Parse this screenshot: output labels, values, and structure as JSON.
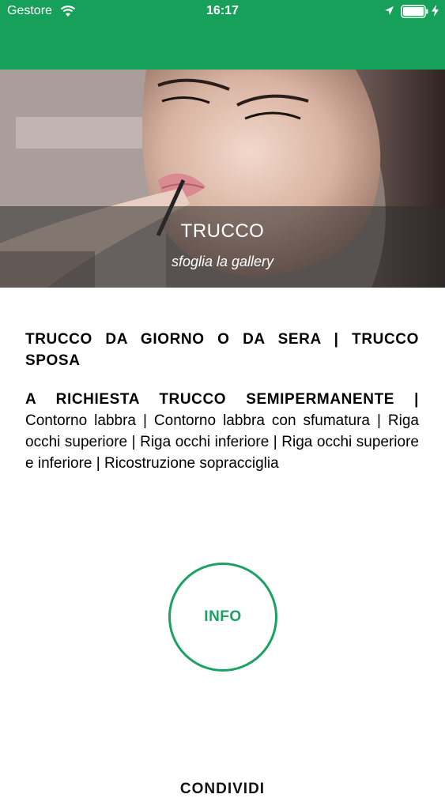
{
  "status_bar": {
    "carrier": "Gestore",
    "time": "16:17",
    "background_color": "#16a05a",
    "icons": [
      "wifi-icon",
      "location-arrow-icon",
      "battery-icon",
      "charging-bolt-icon"
    ]
  },
  "hero": {
    "image_description": "makeup-lipstick-photo",
    "title": "TRUCCO",
    "subtitle": "sfoglia la gallery"
  },
  "content": {
    "heading": "TRUCCO DA GIORNO O DA SERA | TRUCCO SPOSA",
    "paragraph_bold": "A RICHIESTA TRUCCO SEMIPERMANENTE |",
    "paragraph_text": " Contorno labbra | Contorno labbra con sfumatura | Riga occhi superiore | Riga occhi inferiore | Riga occhi superiore e inferiore | Ricostruzione sopracciglia"
  },
  "info_button": {
    "label": "INFO",
    "color": "#1aa262"
  },
  "share": {
    "label": "CONDIVIDI"
  }
}
